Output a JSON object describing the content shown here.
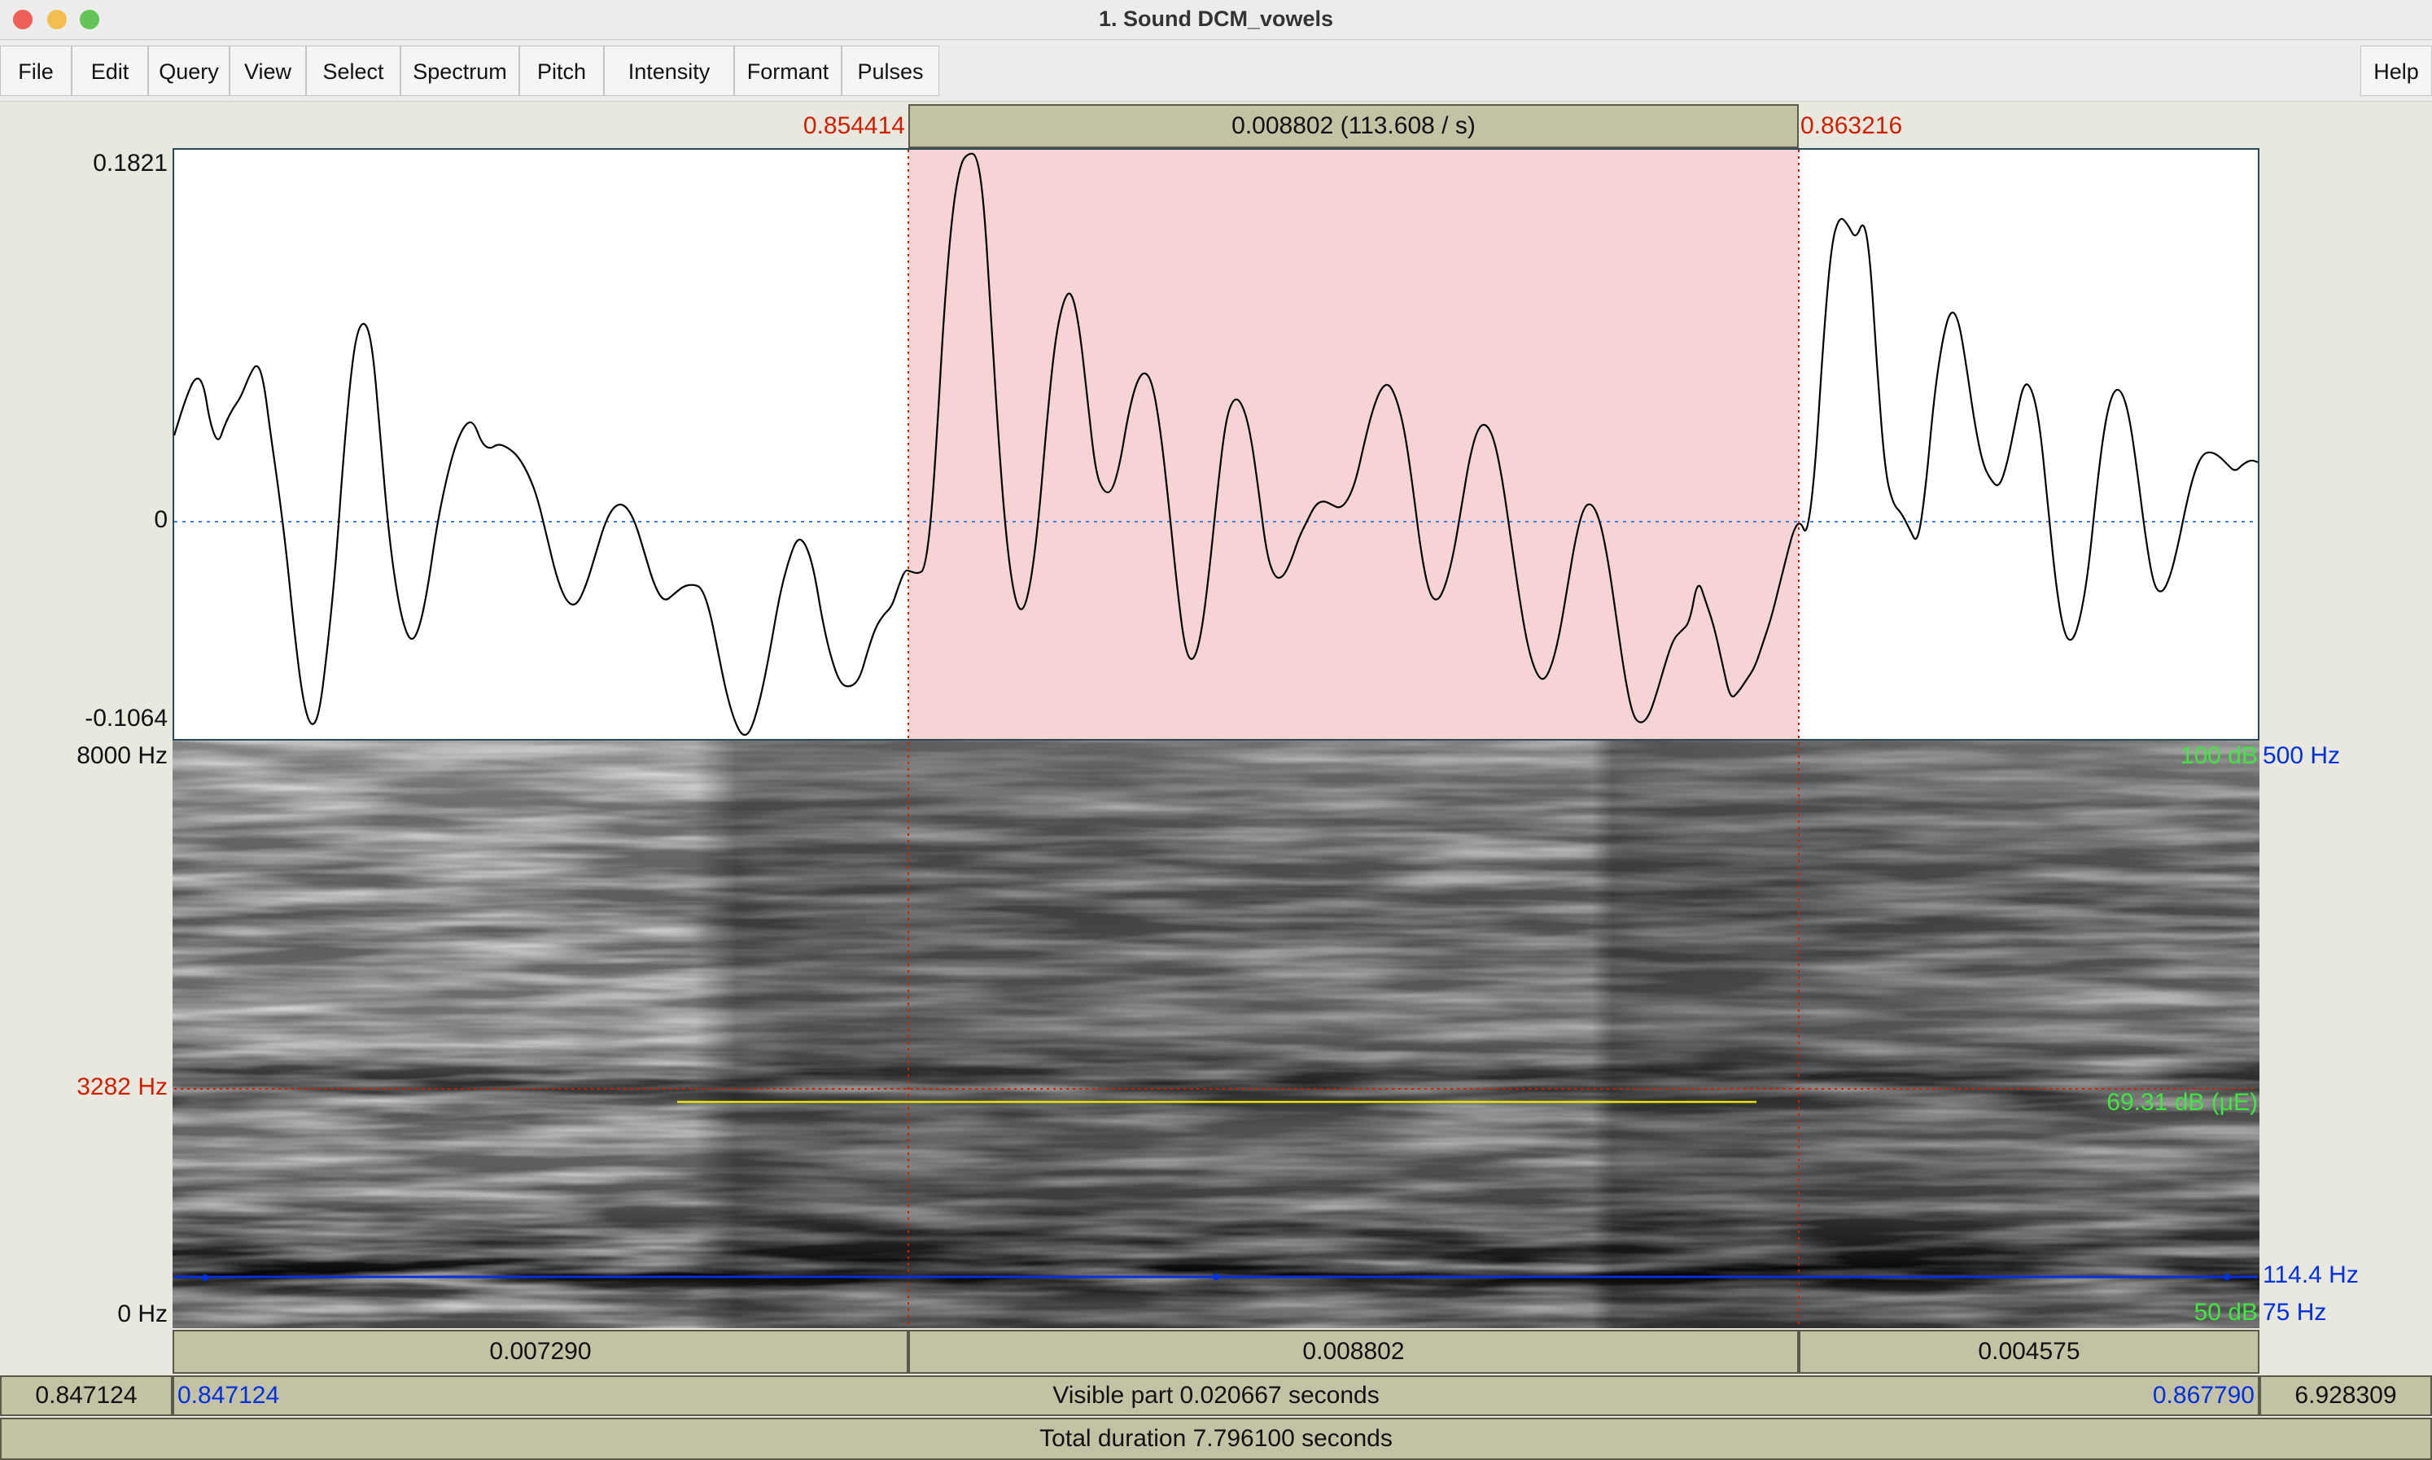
{
  "window": {
    "title": "1. Sound DCM_vowels"
  },
  "menu": [
    "File",
    "Edit",
    "Query",
    "View",
    "Select",
    "Spectrum",
    "Pitch",
    "Intensity",
    "Formant",
    "Pulses"
  ],
  "help_label": "Help",
  "selection": {
    "start": "0.854414",
    "end": "0.863216",
    "duration_label": "0.008802 (113.608 / s)"
  },
  "waveform": {
    "max": "0.1821",
    "zero": "0",
    "min": "-0.1064"
  },
  "spectrogram": {
    "top": "8000 Hz",
    "cursor_freq": "3282 Hz",
    "bottom": "0 Hz",
    "intensity_top": "100 dB",
    "pitch_top": "500 Hz",
    "intensity_value": "69.31 dB (μE)",
    "pitch_value": "114.4 Hz",
    "intensity_bottom": "50 dB",
    "pitch_bottom": "75 Hz"
  },
  "segments": [
    "0.007290",
    "0.008802",
    "0.004575"
  ],
  "visible": {
    "left_outer": "0.847124",
    "left": "0.847124",
    "label": "Visible part 0.020667 seconds",
    "right": "0.867790",
    "right_outer": "6.928309"
  },
  "total": "Total duration 7.796100 seconds",
  "colors": {
    "selection": "#f6d3d5",
    "cursor": "#d01f00",
    "pitch": "#0030e0",
    "intensity": "#3ee83e",
    "formant": "#e8e400"
  }
}
